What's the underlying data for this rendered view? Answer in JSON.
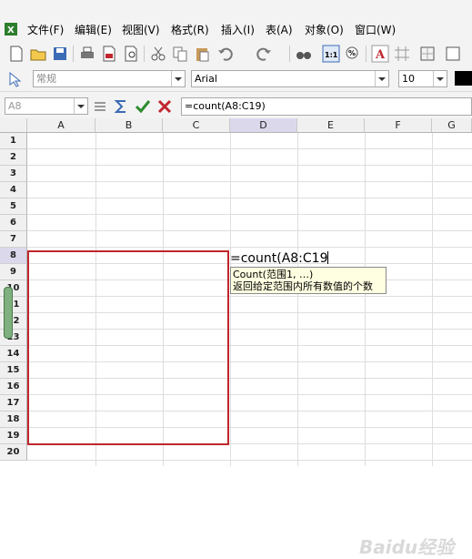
{
  "menubar": {
    "items": [
      "文件(F)",
      "编辑(E)",
      "视图(V)",
      "格式(R)",
      "插入(I)",
      "表(A)",
      "对象(O)",
      "窗口(W)"
    ]
  },
  "toolbar2": {
    "style_value": "常规",
    "font_value": "Arial",
    "size_value": "10"
  },
  "formulabar": {
    "cell_ref": "A8",
    "formula": "=count(A8:C19)"
  },
  "grid": {
    "columns": [
      "A",
      "B",
      "C",
      "D",
      "E",
      "F",
      "G"
    ],
    "rows": [
      "1",
      "2",
      "3",
      "4",
      "5",
      "6",
      "7",
      "8",
      "9",
      "10",
      "11",
      "12",
      "13",
      "14",
      "15",
      "16",
      "17",
      "18",
      "19",
      "20"
    ],
    "selected_column": "D",
    "selected_row": "8"
  },
  "editing": {
    "cell_text": "=count(A8:C19",
    "tooltip_signature": "Count(范围1, …)",
    "tooltip_description": "返回给定范围内所有数值的个数"
  },
  "watermark": {
    "text": "Baidu经验"
  },
  "colors": {
    "selection": "#c0262d",
    "tooltip_bg": "#ffffe1",
    "header_selected": "#dcd8ec"
  }
}
